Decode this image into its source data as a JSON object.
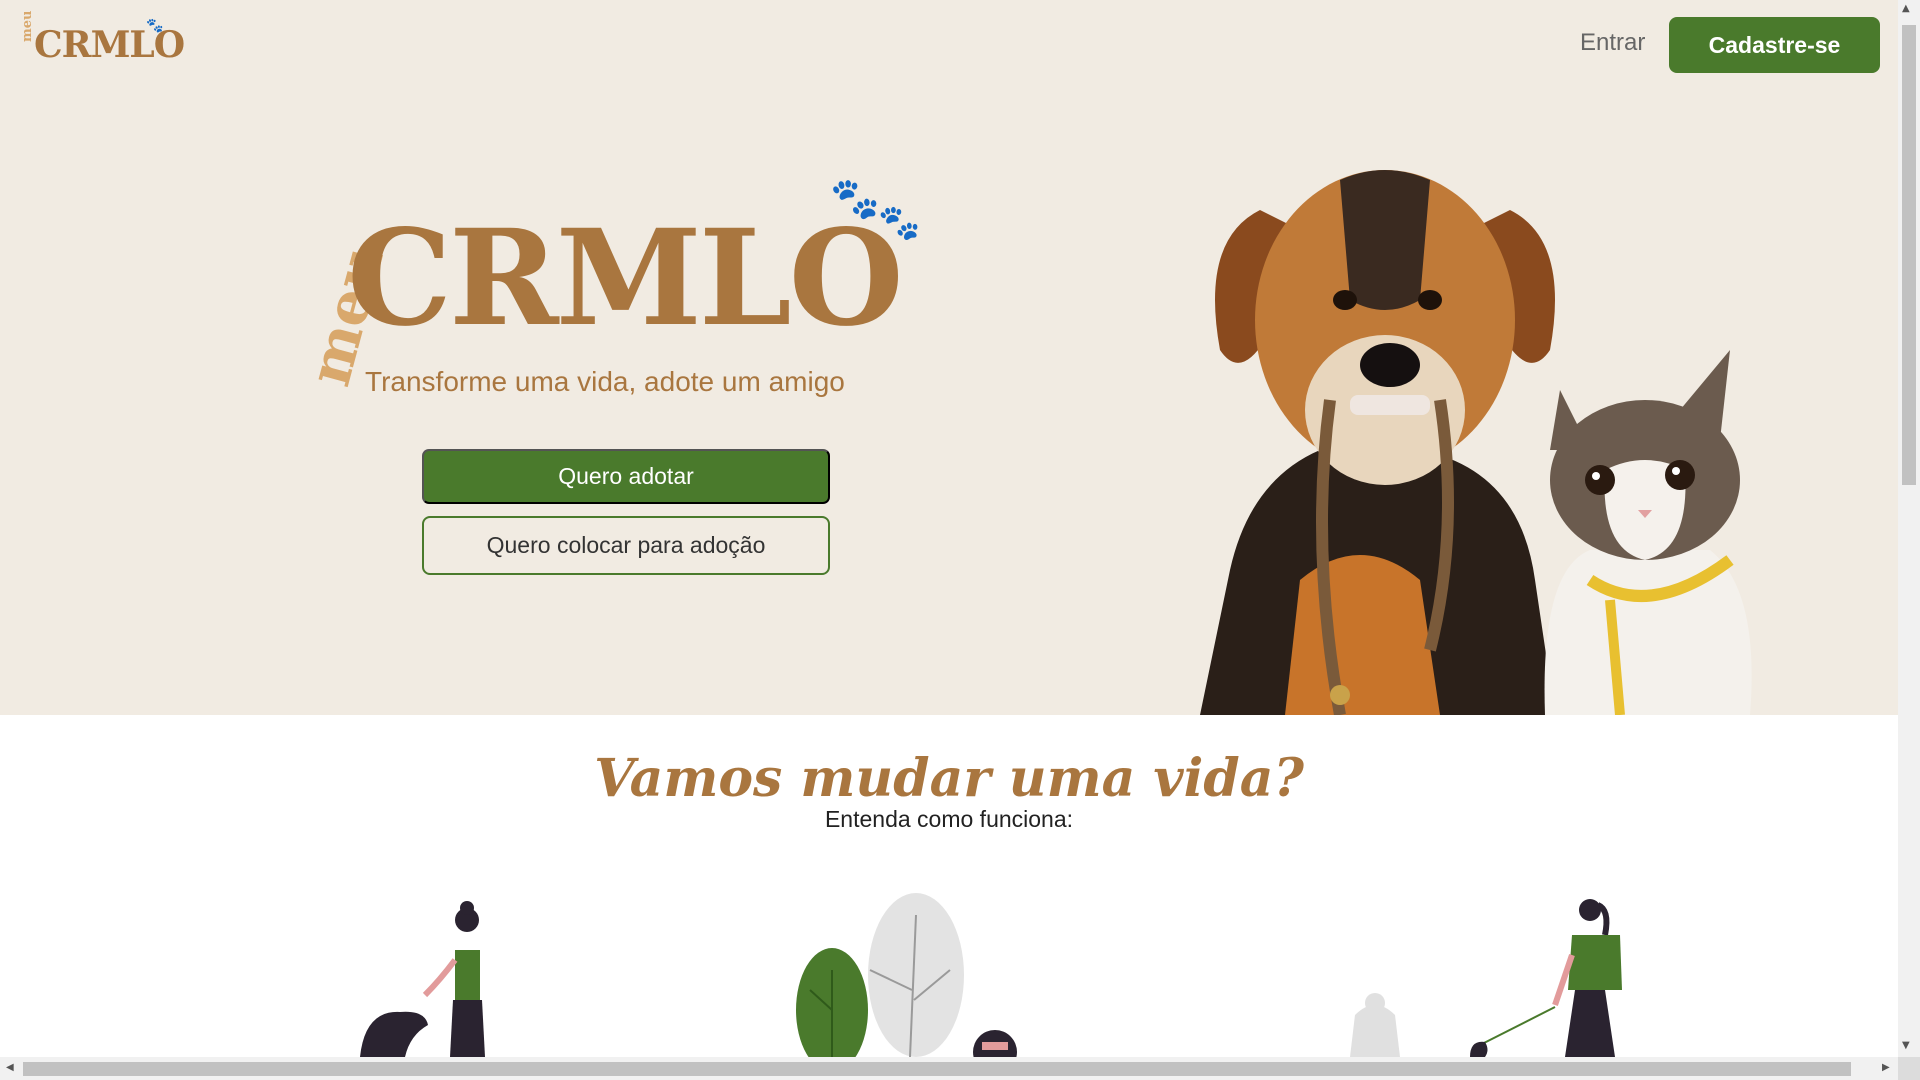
{
  "header": {
    "brand_meu": "meu",
    "brand_name": "CRMLO",
    "login_label": "Entrar",
    "signup_label": "Cadastre-se"
  },
  "hero": {
    "brand_meu": "meu",
    "brand_name": "CRMLO",
    "tagline": "Transforme uma vida, adote um amigo",
    "adopt_button": "Quero adotar",
    "give_button": "Quero colocar para adoção",
    "image_alt": "dog-and-cat-photo"
  },
  "how_it_works": {
    "title": "Vamos mudar uma vida?",
    "subtitle": "Entenda como funciona:"
  },
  "colors": {
    "brand_brown": "#a9763f",
    "brand_light": "#d9a86c",
    "primary_green": "#4a7a2c",
    "hero_bg": "#f1ebe2"
  }
}
